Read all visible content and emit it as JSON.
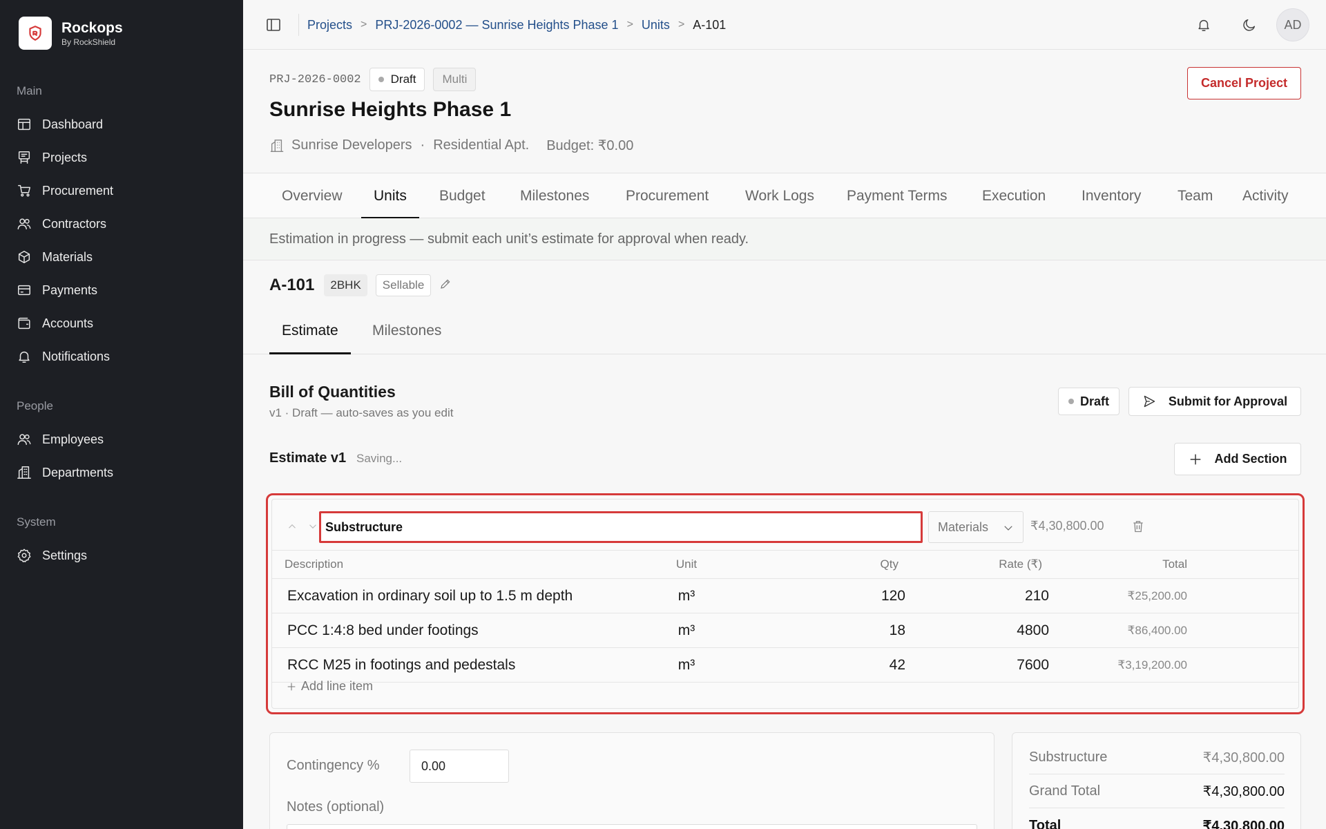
{
  "sidebar": {
    "brand_name": "Rockops",
    "brand_sub": "By RockShield",
    "groups": [
      {
        "heading": "Main",
        "items": [
          {
            "label": "Dashboard",
            "icon": "dashboard-icon"
          },
          {
            "label": "Projects",
            "icon": "projects-icon"
          },
          {
            "label": "Procurement",
            "icon": "cart-icon"
          },
          {
            "label": "Contractors",
            "icon": "users-icon"
          },
          {
            "label": "Materials",
            "icon": "box-icon"
          },
          {
            "label": "Payments",
            "icon": "card-icon"
          },
          {
            "label": "Accounts",
            "icon": "wallet-icon"
          },
          {
            "label": "Notifications",
            "icon": "bell-icon"
          }
        ]
      },
      {
        "heading": "People",
        "items": [
          {
            "label": "Employees",
            "icon": "users-icon"
          },
          {
            "label": "Departments",
            "icon": "building-icon"
          }
        ]
      },
      {
        "heading": "System",
        "items": [
          {
            "label": "Settings",
            "icon": "gear-icon"
          }
        ]
      }
    ]
  },
  "header": {
    "breadcrumb": [
      "Projects",
      "PRJ-2026-0002 — Sunrise Heights Phase 1",
      "Units",
      "A-101"
    ],
    "avatar": "AD"
  },
  "project": {
    "code": "PRJ-2026-0002",
    "status": "Draft",
    "mode": "Multi",
    "title": "Sunrise Heights Phase 1",
    "developer": "Sunrise Developers",
    "sep": "·",
    "type": "Residential Apt.",
    "budget": "Budget: ₹0.00",
    "cancel_label": "Cancel Project"
  },
  "tabs": [
    "Overview",
    "Units",
    "Budget",
    "Milestones",
    "Procurement",
    "Work Logs",
    "Payment Terms",
    "Execution",
    "Inventory",
    "Team",
    "Activity"
  ],
  "active_tab": "Units",
  "banner": "Estimation in progress — submit each unit’s estimate for approval when ready.",
  "unit": {
    "name": "A-101",
    "type": "2BHK",
    "sellable": "Sellable",
    "subtabs": [
      "Estimate",
      "Milestones"
    ]
  },
  "boq": {
    "title": "Bill of Quantities",
    "subtitle": "v1 · Draft — auto-saves as you edit",
    "status": "Draft",
    "submit_label": "Submit for Approval",
    "estimate_title": "Estimate v1",
    "saving": "Saving...",
    "add_section_label": "Add Section",
    "section": {
      "name": "Substructure",
      "type": "Materials",
      "total": "₹4,30,800.00",
      "columns": {
        "desc": "Description",
        "unit": "Unit",
        "qty": "Qty",
        "rate": "Rate (₹)",
        "total": "Total"
      },
      "rows": [
        {
          "desc": "Excavation in ordinary soil up to 1.5 m depth",
          "unit": "m³",
          "qty": "120",
          "rate": "210",
          "total": "₹25,200.00"
        },
        {
          "desc": "PCC 1:4:8 bed under footings",
          "unit": "m³",
          "qty": "18",
          "rate": "4800",
          "total": "₹86,400.00"
        },
        {
          "desc": "RCC M25 in footings and pedestals",
          "unit": "m³",
          "qty": "42",
          "rate": "7600",
          "total": "₹3,19,200.00"
        }
      ],
      "add_line_label": "Add line item"
    }
  },
  "contingency": {
    "label": "Contingency %",
    "value": "0.00",
    "notes_label": "Notes (optional)"
  },
  "summary": {
    "rows": [
      {
        "label": "Substructure",
        "value": "₹4,30,800.00"
      },
      {
        "label": "Grand Total",
        "value": "₹4,30,800.00"
      },
      {
        "label": "Total",
        "value": "₹4,30,800.00"
      }
    ]
  }
}
